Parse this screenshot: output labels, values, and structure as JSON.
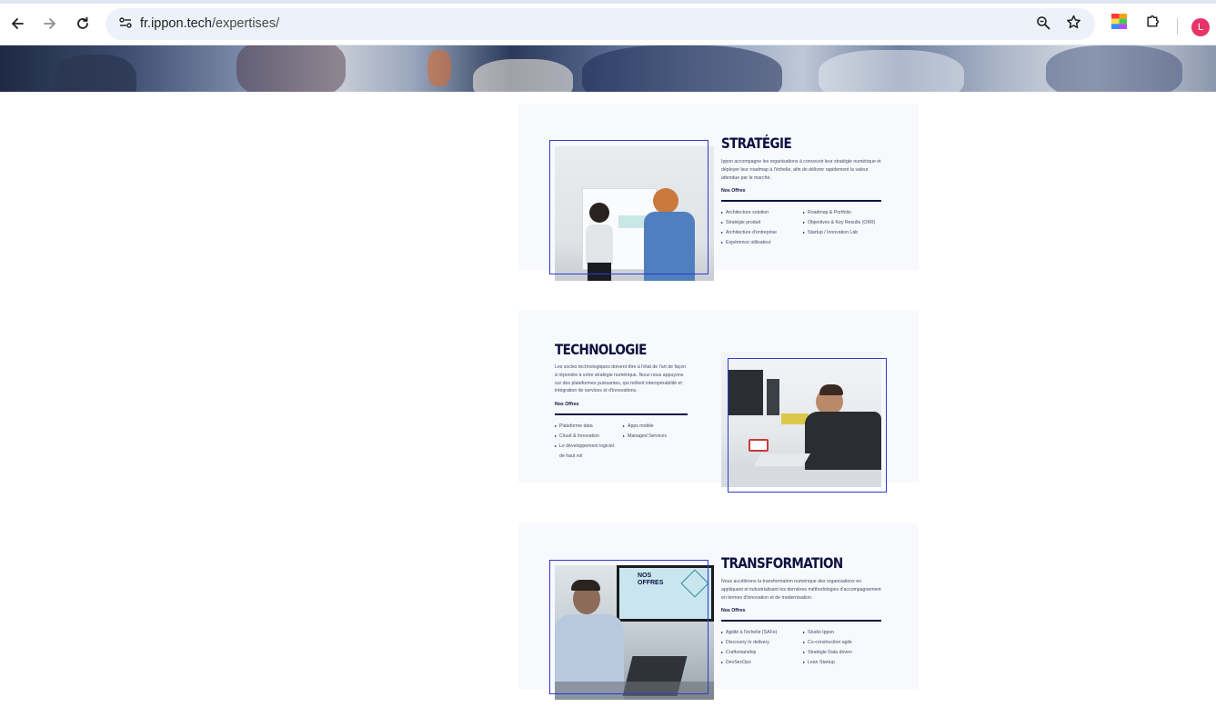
{
  "browser": {
    "url_host": "fr.ippon.tech",
    "url_path": "/expertises/",
    "profile_initial": "L"
  },
  "colors": {
    "title_navy": "#0d1140",
    "frame_blue": "#2d3bd1",
    "card_bg": "#f8f9fd",
    "omnibox_bg": "#edf2fa",
    "avatar_pink": "#e8336a"
  },
  "icons": [
    "back-arrow-icon",
    "forward-arrow-icon",
    "reload-icon",
    "site-info-icon",
    "zoom-icon",
    "bookmark-star-icon",
    "color-extension-icon",
    "puzzle-extensions-icon"
  ],
  "sections": [
    {
      "title": "STRATÉGIE",
      "description": "Ippon accompagne les organisations à concevoir leur stratégie numérique et déployer leur roadmap à l'échelle, afin de délivrer rapidement la valeur attendue par le marché.",
      "offers_label": "Nos Offres",
      "offers_left": [
        "Architecture solution",
        "Stratégie produit",
        "Architecture d'entreprise",
        "Expérience utilisateur"
      ],
      "offers_right": [
        "Roadmap & Portfolio",
        "Objectives & Key Results (OKR)",
        "Startup / Innovation Lab"
      ]
    },
    {
      "title": "TECHNOLOGIE",
      "description": "Les socles technologiques doivent être à l'état de l'art de façon à répondre à votre stratégie numérique. Nous nous appuyons sur des plateformes puissantes, qui mêlent interopérabilité et intégration de services et d'innovations.",
      "offers_label": "Nos Offres",
      "offers_left": [
        "Plateforme data",
        "Cloud & Innovation",
        "Le développement logiciel de haut vol"
      ],
      "offers_right": [
        "Apps mobile",
        "Managed Services"
      ]
    },
    {
      "title": "TRANSFORMATION",
      "description": "Nous accélérons la transformation numérique des organisations en appliquant et industrialisant les dernières méthodologies d'accompagnement en termes d'innovation et de modernisation.",
      "offers_label": "Nos Offres",
      "offers_left": [
        "Agilité à l'échelle (SAFe)",
        "Discovery to delivery",
        "Craftsmanship",
        "DevSecOps"
      ],
      "offers_right": [
        "Studio Ippon",
        "Co-construction agile",
        "Stratégie Data driven",
        "Lean Startup"
      ]
    }
  ],
  "slide_text": "NOS OFFRES"
}
